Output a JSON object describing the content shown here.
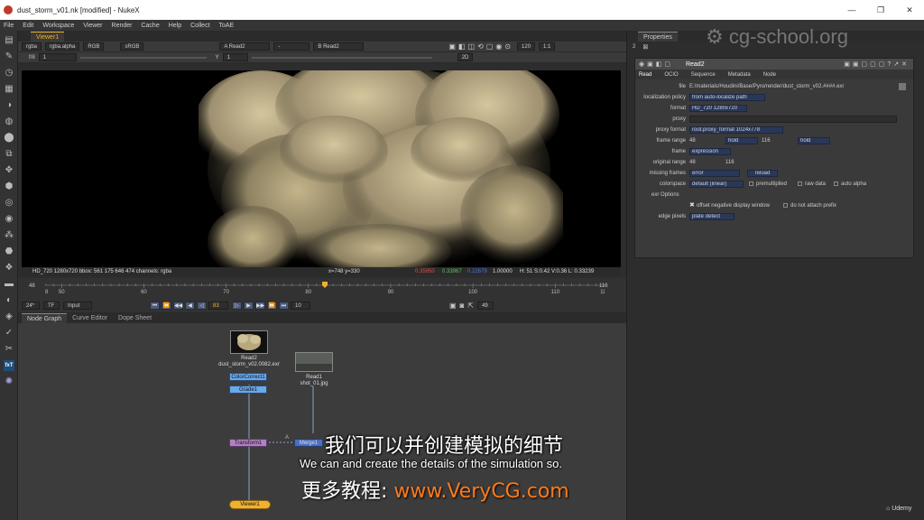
{
  "window": {
    "title": "dust_storm_v01.nk [modified] - NukeX",
    "controls": [
      "—",
      "❐",
      "✕"
    ]
  },
  "menu": [
    "File",
    "Edit",
    "Workspace",
    "Viewer",
    "Render",
    "Cache",
    "Help",
    "Collect",
    "ToAE"
  ],
  "viewer": {
    "tab": "Viewer1",
    "channels": "rgba",
    "alpha": "rgba.alpha",
    "colors": "RGB",
    "lut": "sRGB",
    "input_a": "A  Read2",
    "input_b": "B  Read2",
    "fstop": "f/8",
    "gain": "1",
    "gamma_label": "Y",
    "gamma": "1",
    "zoom": "120",
    "ratio": "1:1",
    "view": "2D",
    "info": {
      "format": "HD_720 1280x720  bbox: 561 175 646 474 channels: rgba",
      "coords": "x=748 y=330",
      "r": "0.35950",
      "g": "0.33967",
      "b": "0.22679",
      "a": "1.00000",
      "hsv": "H: 51 S:0.42 V:0.36  L: 0.33239"
    }
  },
  "timeline": {
    "start": "48",
    "end": "116",
    "ticks": [
      "48",
      "50",
      "60",
      "70",
      "80",
      "90",
      "100",
      "110",
      "116"
    ],
    "fps": "24*",
    "tf": "TF",
    "mode": "Input",
    "current_frame": "83",
    "increment": "10",
    "frame_display": "49",
    "current": 82
  },
  "nodegraph": {
    "tabs": [
      "Node Graph",
      "Curve Editor",
      "Dope Sheet"
    ],
    "nodes": {
      "read2": "Read2",
      "read2_file": "dust_storm_v02.0082.exr",
      "read1": "Read1",
      "read1_file": "shot_01.jpg",
      "colorcorrect": "ColorCorrect1",
      "grade": "Grade1",
      "transform": "Transform1",
      "merge": "Merge1",
      "viewer": "Viewer1",
      "pipe_a": "A"
    }
  },
  "properties": {
    "title": "Properties",
    "max_panels": "2",
    "node_name": "Read2",
    "tabs": [
      "Read",
      "OCIO",
      "Sequence",
      "Metadata",
      "Node"
    ],
    "file_label": "file",
    "file": "E:/materials/Houdini/Base/Pyro/render/dust_storm_v02.####.exr",
    "localization_label": "localization policy",
    "localization": "from auto-localize path",
    "format_label": "format",
    "format": "HD_720 1280x720",
    "proxy_label": "proxy",
    "proxy_format_label": "proxy format",
    "proxy_format": "root.proxy_format 1024x778",
    "frame_range_label": "frame range",
    "frame_start": "48",
    "frame_start_mode": "hold",
    "frame_end": "116",
    "frame_end_mode": "hold",
    "frame_label": "frame",
    "frame": "expression",
    "original_range_label": "original range",
    "orig_start": "48",
    "orig_end": "116",
    "missing_frames_label": "missing frames",
    "missing_frames": "error",
    "reload": "reload",
    "colorspace_label": "colorspace",
    "colorspace": "default (linear)",
    "premultiplied": "premultiplied",
    "raw_data": "raw data",
    "auto_alpha": "auto alpha",
    "exr_options": "exr Options",
    "offset_negative": "offset negative display window",
    "do_not_attach": "do not attach prefix",
    "edge_pixels_label": "edge pixels",
    "edge_pixels": "plate detect"
  },
  "overlay": {
    "subtitle_zh": "我们可以并创建模拟的细节",
    "subtitle_en": "We can and create the details of the simulation so.",
    "watermark_zh": "更多教程:",
    "watermark_url": "www.VeryCG.com",
    "cgschool": "cg-school.org",
    "udemy": "Udemy"
  },
  "colors": {
    "accent": "#f0b030",
    "url": "#ff7a1a",
    "field": "#2a3858"
  }
}
